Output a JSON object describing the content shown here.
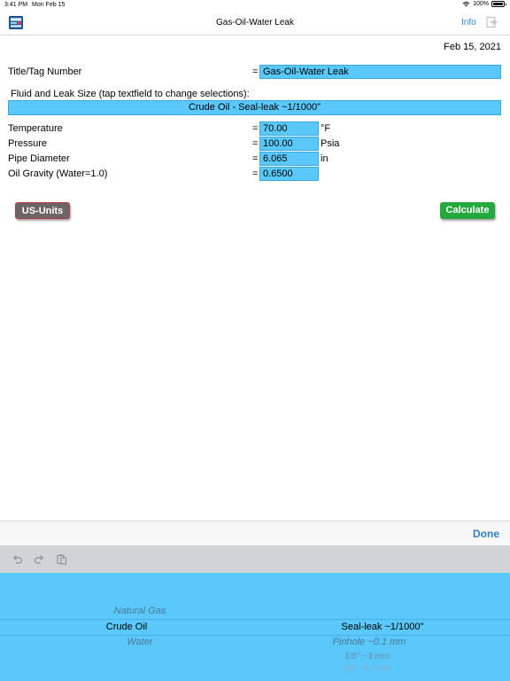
{
  "status": {
    "time": "3:41 PM",
    "date": "Mon Feb 15",
    "battery": "100%"
  },
  "nav": {
    "title": "Gas-Oil-Water Leak",
    "info_label": "Info"
  },
  "form": {
    "date": "Feb 15, 2021",
    "equals": "=",
    "title_label": "Title/Tag Number",
    "title_value": "Gas-Oil-Water Leak",
    "fluid_label": "Fluid and Leak Size (tap textfield to change selections):",
    "fluid_value": "Crude Oil   -   Seal-leak ~1/1000\"",
    "rows": [
      {
        "label": "Temperature",
        "value": "70.00",
        "unit": "°F"
      },
      {
        "label": "Pressure",
        "value": "100.00",
        "unit": "Psia"
      },
      {
        "label": "Pipe Diameter",
        "value": "6.065",
        "unit": "in"
      },
      {
        "label": "Oil Gravity (Water=1.0)",
        "value": "0.6500",
        "unit": ""
      }
    ]
  },
  "buttons": {
    "units": "US-Units",
    "calculate": "Calculate"
  },
  "keyboard": {
    "done": "Done"
  },
  "picker": {
    "fluids": [
      "Natural Gas",
      "Crude Oil",
      "Water"
    ],
    "sizes": [
      "Seal-leak ~1/1000\"",
      "Pinhole ~0.1 mm",
      "1/8\" ~3 mm",
      "1/4\" ~6.3 mm"
    ]
  },
  "colors": {
    "field_bg": "#5ac8fa",
    "calculate_bg": "#25a83c",
    "units_bg": "#6e6466",
    "link": "#3080d8"
  }
}
